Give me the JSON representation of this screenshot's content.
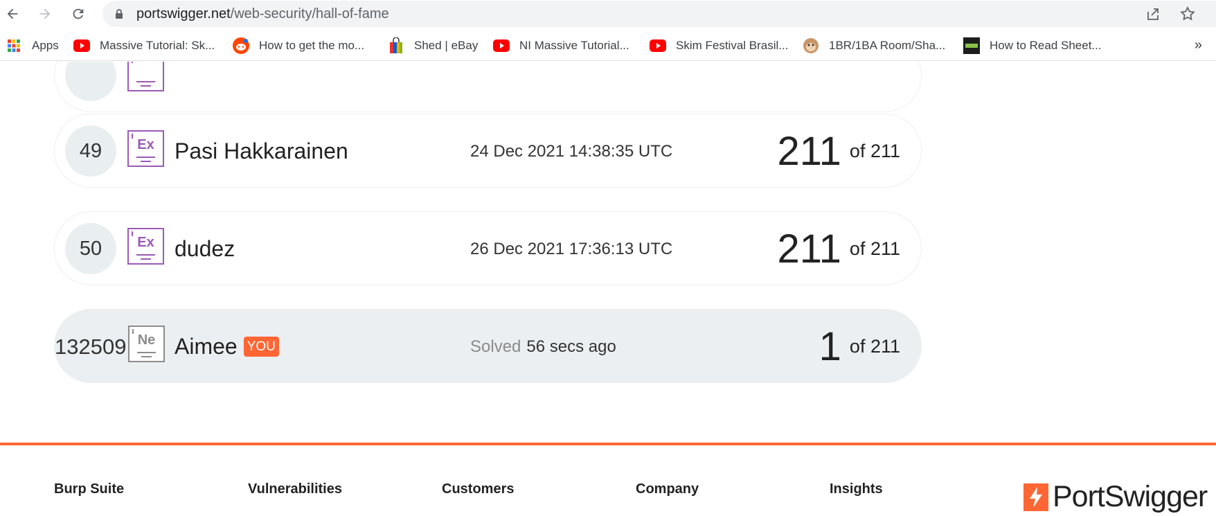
{
  "browser": {
    "url_host": "portswigger.net",
    "url_path": "/web-security/hall-of-fame",
    "bookmarks": [
      {
        "label": "Apps",
        "icon": "apps-grid-icon"
      },
      {
        "label": "Massive Tutorial: Sk...",
        "icon": "youtube-icon"
      },
      {
        "label": "How to get the mo...",
        "icon": "reddit-icon"
      },
      {
        "label": "Shed | eBay",
        "icon": "shopping-bag-icon"
      },
      {
        "label": "NI Massive Tutorial...",
        "icon": "youtube-icon"
      },
      {
        "label": "Skim Festival Brasil...",
        "icon": "youtube-icon"
      },
      {
        "label": "1BR/1BA Room/Sha...",
        "icon": "monkey-icon"
      },
      {
        "label": "How to Read Sheet...",
        "icon": "now-icon"
      }
    ],
    "more": "»"
  },
  "hall": {
    "rows": [
      {
        "rank": "49",
        "badge": "Ex",
        "name": "Pasi Hakkarainen",
        "date": "24 Dec 2021 14:38:35 UTC",
        "score": "211",
        "of": "of 211"
      },
      {
        "rank": "50",
        "badge": "Ex",
        "name": "dudez",
        "date": "26 Dec 2021 17:36:13 UTC",
        "score": "211",
        "of": "of 211"
      }
    ],
    "me": {
      "rank": "132509",
      "badge": "Ne",
      "name": "Aimee",
      "you": "YOU",
      "solved_label": "Solved",
      "solved_time": "56 secs ago",
      "score": "1",
      "of": "of 211"
    }
  },
  "footer": {
    "columns": [
      "Burp Suite",
      "Vulnerabilities",
      "Customers",
      "Company",
      "Insights"
    ],
    "brand": "PortSwigger",
    "accent": "#ff6633"
  }
}
